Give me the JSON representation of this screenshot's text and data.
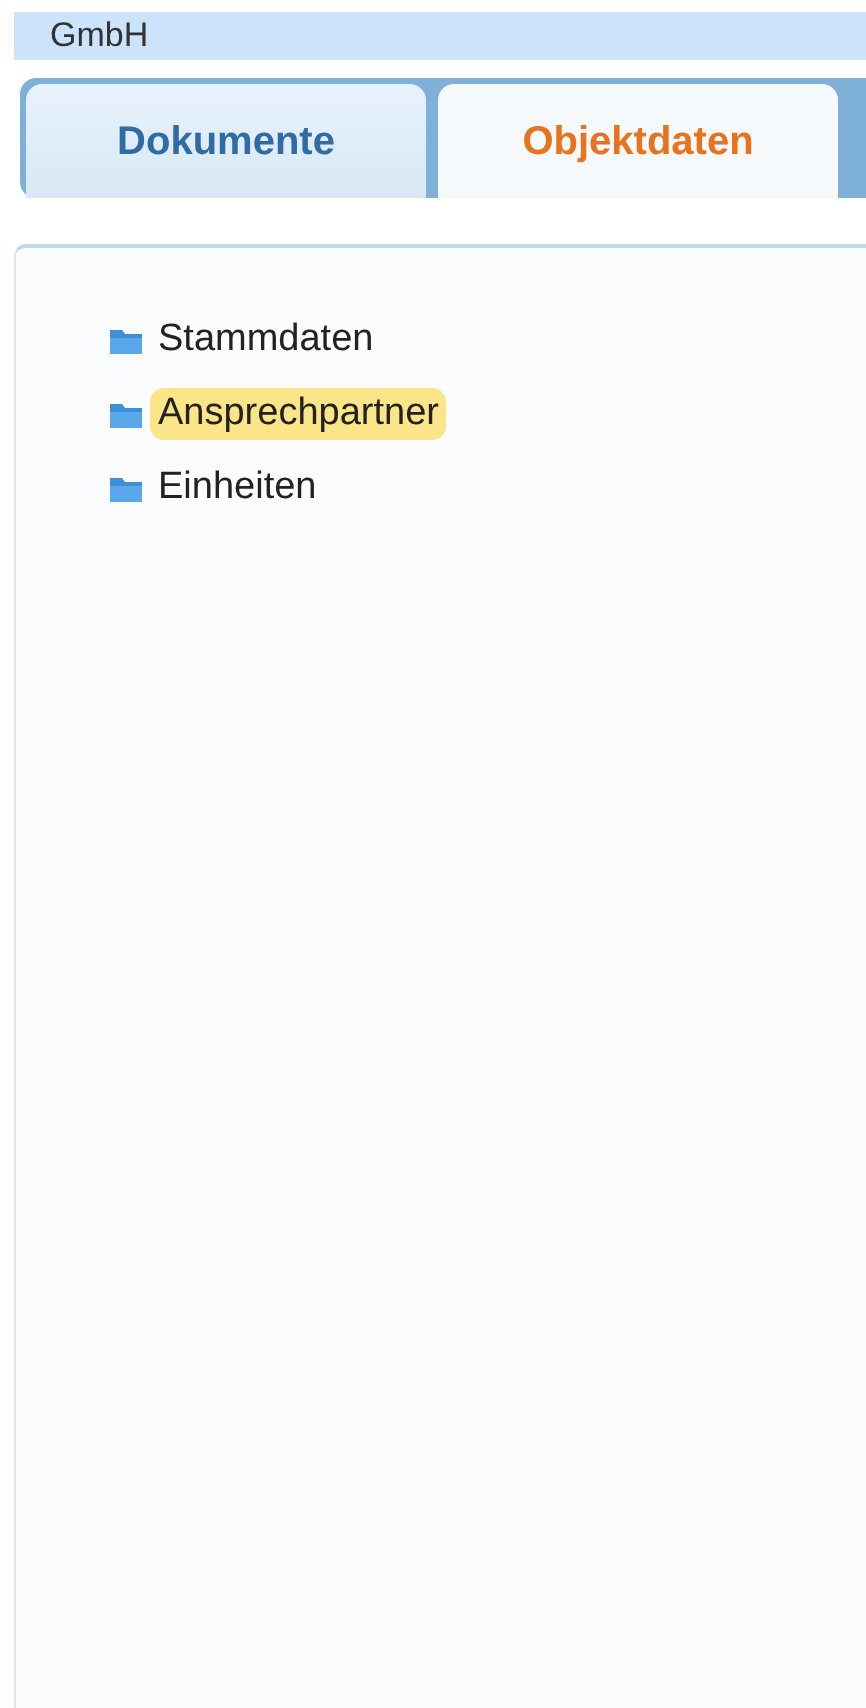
{
  "header": {
    "title": "GmbH"
  },
  "tabs": [
    {
      "label": "Dokumente",
      "selected": false
    },
    {
      "label": "Objektdaten",
      "selected": true
    }
  ],
  "tree": {
    "items": [
      {
        "label": "Stammdaten",
        "selected": false
      },
      {
        "label": "Ansprechpartner",
        "selected": true
      },
      {
        "label": "Einheiten",
        "selected": false
      }
    ]
  }
}
